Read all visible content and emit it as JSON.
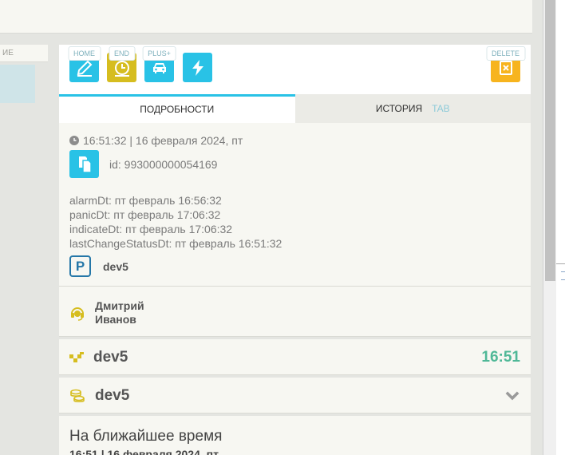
{
  "left_panel": {
    "header_fragment": "ИЕ"
  },
  "toolbar": {
    "buttons": [
      {
        "icon": "pencil-icon",
        "hotkey": "HOME",
        "color": "#29c2e6"
      },
      {
        "icon": "clock-icon",
        "hotkey": "END",
        "color": "#d6bd1f"
      },
      {
        "icon": "car-icon",
        "hotkey": "PLUS+",
        "color": "#29c2e6"
      },
      {
        "icon": "lightning-icon",
        "hotkey": "",
        "color": "#29c2e6"
      }
    ],
    "delete": {
      "icon": "delete-icon",
      "hotkey": "DELETE",
      "color": "#f7b41e"
    }
  },
  "tabs": {
    "details": "ПОДРОБНОСТИ",
    "history": "ИСТОРИЯ",
    "history_hint": "TAB"
  },
  "details": {
    "timestamp": "16:51:32 | 16 февраля 2024, пт",
    "id": "id: 993000000054169",
    "dates": [
      "alarmDt: пт февраль 16:56:32",
      "panicDt: пт февраль 17:06:32",
      "indicateDt: пт февраль 17:06:32",
      "lastChangeStatusDt: пт февраль 16:51:32"
    ],
    "parking_badge": "P",
    "parking": "dev5"
  },
  "operator": {
    "first_name": "Дмитрий",
    "last_name": "Иванов"
  },
  "car": {
    "name": "dev5",
    "time": "16:51",
    "time_color": "#4fb897"
  },
  "tariff": {
    "name": "dev5"
  },
  "schedule": {
    "title": "На ближайшее время",
    "subtitle": "16:51 | 16 февраля 2024, пт"
  }
}
